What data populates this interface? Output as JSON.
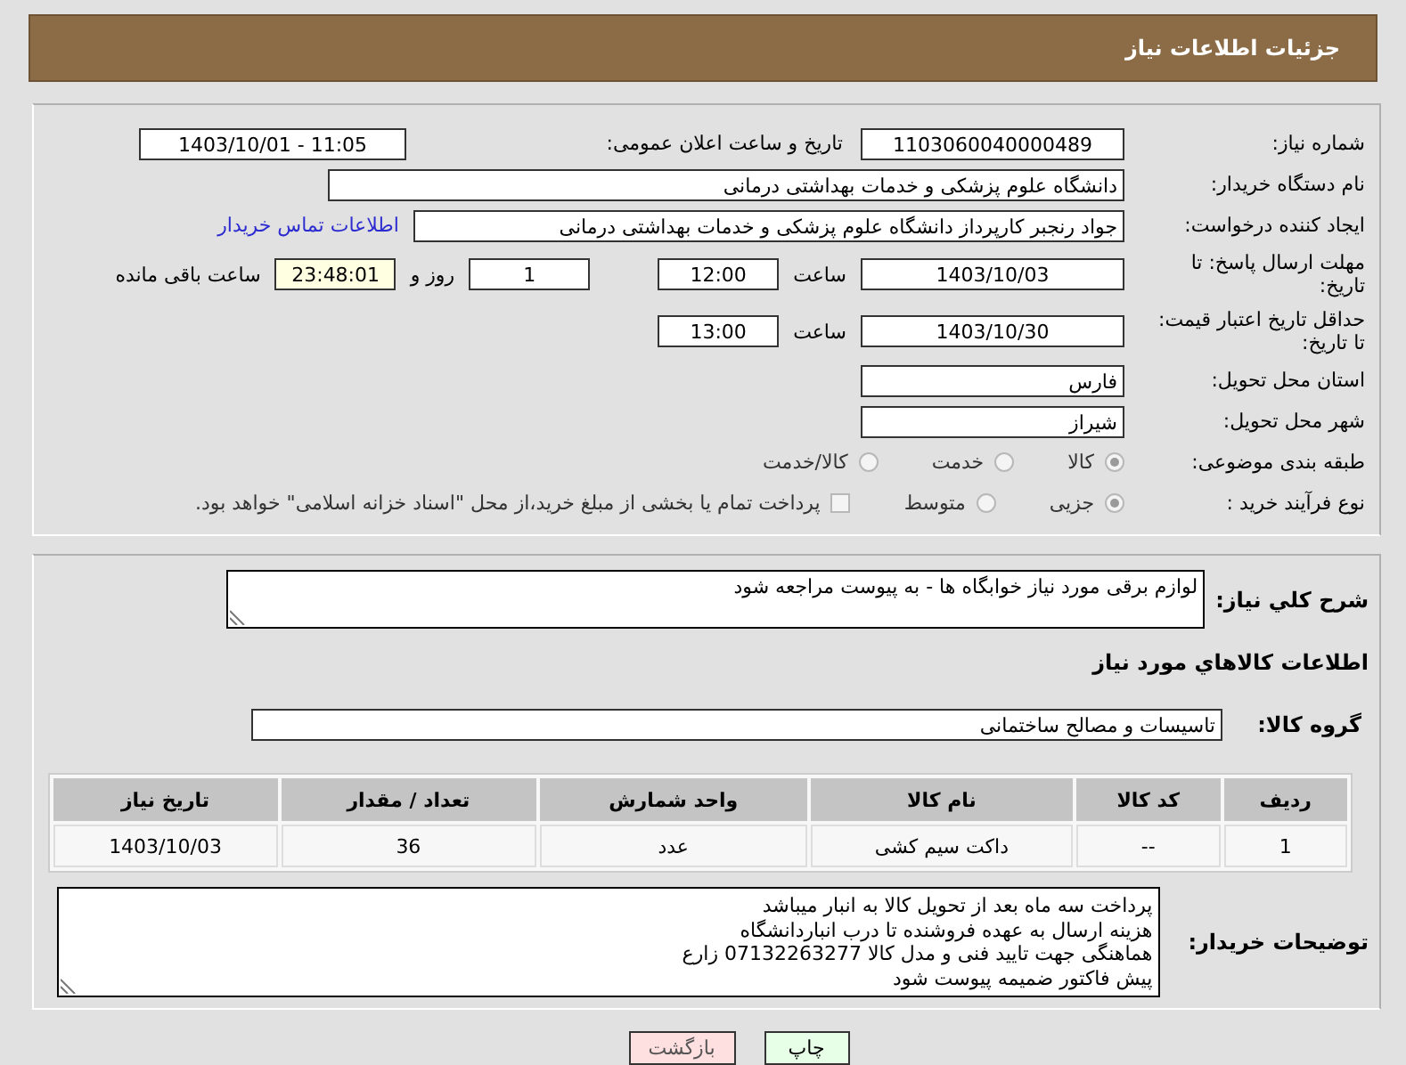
{
  "header": {
    "title": "جزئیات اطلاعات نیاز"
  },
  "need_number": {
    "label": "شماره نیاز:",
    "value": "1103060040000489"
  },
  "announce": {
    "label": "تاریخ و ساعت اعلان عمومی:",
    "value": "1403/10/01 - 11:05"
  },
  "buyer_org": {
    "label": "نام دستگاه خریدار:",
    "value": "دانشگاه علوم پزشکی و خدمات بهداشتی درمانی"
  },
  "requester": {
    "label": "ایجاد کننده درخواست:",
    "value": "جواد رنجبر کارپرداز دانشگاه علوم پزشکی و خدمات بهداشتی درمانی",
    "link": "اطلاعات تماس خریدار"
  },
  "reply_deadline": {
    "label": "مهلت ارسال پاسخ: تا تاریخ:",
    "date": "1403/10/03",
    "time_label": "ساعت",
    "time": "12:00",
    "days": "1",
    "days_label": "روز و",
    "remaining": "23:48:01",
    "remaining_label": "ساعت باقی مانده"
  },
  "price_validity": {
    "label": "حداقل تاریخ اعتبار قیمت: تا تاریخ:",
    "date": "1403/10/30",
    "time_label": "ساعت",
    "time": "13:00"
  },
  "province": {
    "label": "استان محل تحویل:",
    "value": "فارس"
  },
  "city": {
    "label": "شهر محل تحویل:",
    "value": "شیراز"
  },
  "category": {
    "label": "طبقه بندی موضوعی:",
    "options": [
      {
        "label": "کالا",
        "selected": true
      },
      {
        "label": "خدمت",
        "selected": false
      },
      {
        "label": "کالا/خدمت",
        "selected": false
      }
    ]
  },
  "purchase_type": {
    "label": "نوع فرآیند خرید :",
    "options": [
      {
        "label": "جزیی",
        "selected": true
      },
      {
        "label": "متوسط",
        "selected": false
      }
    ],
    "payment": {
      "checked": false,
      "label": "پرداخت تمام یا بخشی از مبلغ خرید،از محل \"اسناد خزانه اسلامی\" خواهد بود."
    }
  },
  "description": {
    "label": "شرح کلي نياز:",
    "value": "لوازم برقی مورد نیاز خوابگاه ها - به پیوست مراجعه شود"
  },
  "items_heading": "اطلاعات کالاهاي مورد نياز",
  "goods_group": {
    "label": "گروه کالا:",
    "value": "تاسیسات و مصالح ساختمانی"
  },
  "table": {
    "columns": [
      "ردیف",
      "کد کالا",
      "نام کالا",
      "واحد شمارش",
      "تعداد / مقدار",
      "تاریخ نیاز"
    ],
    "rows": [
      [
        "1",
        "--",
        "داکت سیم کشی",
        "عدد",
        "36",
        "1403/10/03"
      ]
    ]
  },
  "buyer_notes": {
    "label": "توضیحات خریدار:",
    "lines": [
      "پرداخت سه ماه بعد از تحویل کالا به انبار میباشد",
      "هزینه ارسال به عهده فروشنده تا درب انباردانشگاه",
      "هماهنگی جهت تایید فنی و مدل کالا 07132263277 زارع",
      "پیش فاکتور ضمیمه پیوست شود"
    ]
  },
  "buttons": [
    {
      "label": "چاپ",
      "kind": "print"
    },
    {
      "label": "بازگشت",
      "kind": "back"
    }
  ]
}
